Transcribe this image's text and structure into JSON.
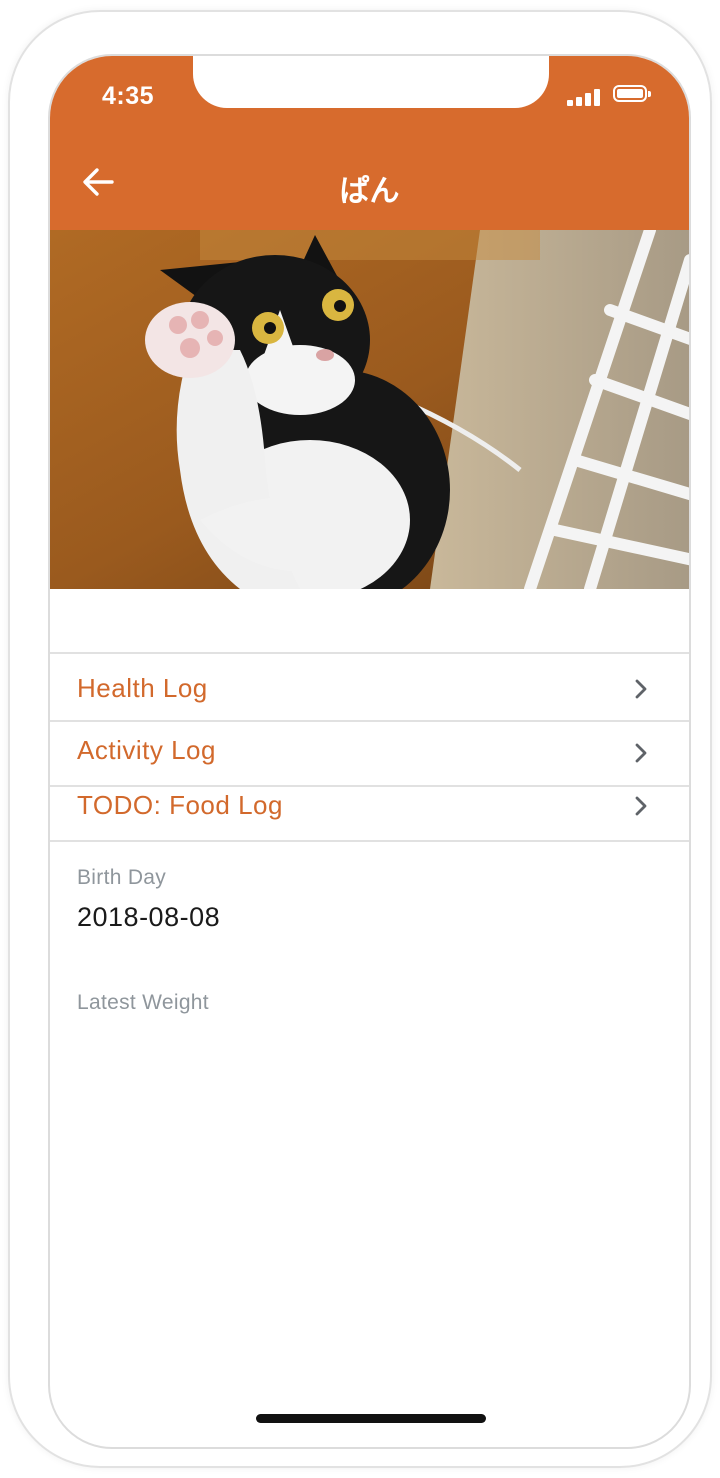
{
  "status_bar": {
    "time": "4:35",
    "icons": [
      "signal-icon",
      "battery-icon"
    ]
  },
  "app_bar": {
    "title": "ぱん",
    "back_icon": "arrow-left-icon",
    "color": "#d76b2d"
  },
  "hero": {
    "image": "cat-photo"
  },
  "menu": {
    "items": [
      {
        "label": "Health Log",
        "icon": "chevron-right-icon"
      },
      {
        "label": "Activity Log",
        "icon": "chevron-right-icon"
      },
      {
        "label": "TODO: Food Log",
        "icon": "chevron-right-icon"
      }
    ],
    "accent_color": "#d2692c"
  },
  "details": {
    "birth_day": {
      "label": "Birth Day",
      "value": "2018-08-08"
    },
    "latest_weight": {
      "label": "Latest Weight",
      "value": ""
    }
  }
}
